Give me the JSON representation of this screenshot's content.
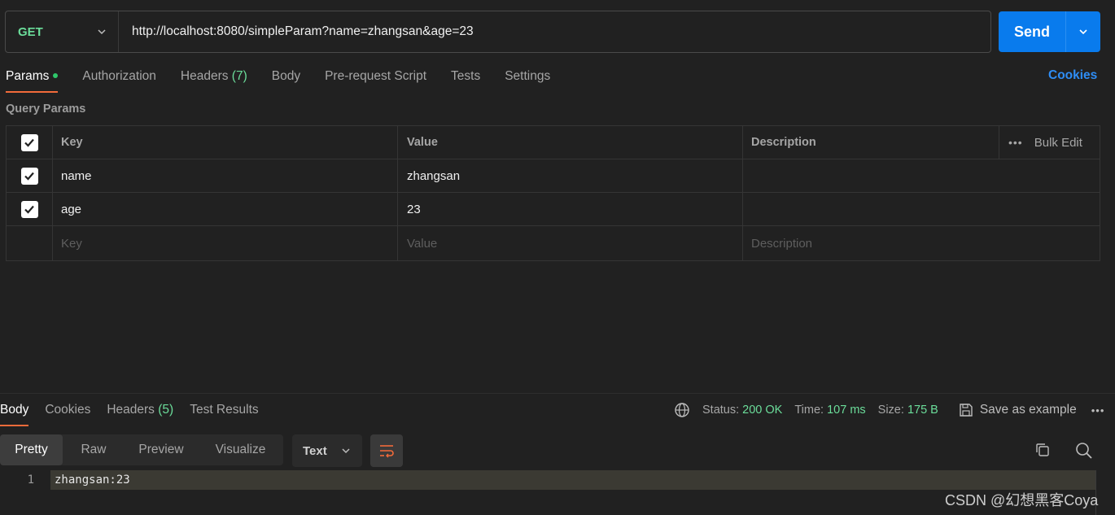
{
  "request": {
    "method": "GET",
    "url": "http://localhost:8080/simpleParam?name=zhangsan&age=23",
    "send_label": "Send"
  },
  "request_tabs": [
    {
      "label": "Params",
      "active": true
    },
    {
      "label": "Authorization"
    },
    {
      "label": "Headers",
      "count": "(7)"
    },
    {
      "label": "Body"
    },
    {
      "label": "Pre-request Script"
    },
    {
      "label": "Tests"
    },
    {
      "label": "Settings"
    }
  ],
  "cookies_link": "Cookies",
  "query_params": {
    "section_label": "Query Params",
    "headers": {
      "key": "Key",
      "value": "Value",
      "description": "Description",
      "bulk_edit": "Bulk Edit"
    },
    "rows": [
      {
        "key": "name",
        "value": "zhangsan",
        "checked": true
      },
      {
        "key": "age",
        "value": "23",
        "checked": true
      }
    ],
    "placeholders": {
      "key": "Key",
      "value": "Value",
      "description": "Description"
    }
  },
  "response": {
    "tabs": [
      {
        "label": "Body",
        "active": true
      },
      {
        "label": "Cookies"
      },
      {
        "label": "Headers",
        "count": "(5)"
      },
      {
        "label": "Test Results"
      }
    ],
    "status_label": "Status:",
    "status_value": "200 OK",
    "time_label": "Time:",
    "time_value": "107 ms",
    "size_label": "Size:",
    "size_value": "175 B",
    "save_example": "Save as example",
    "view_modes": [
      "Pretty",
      "Raw",
      "Preview",
      "Visualize"
    ],
    "format": "Text",
    "lines": [
      {
        "number": "1",
        "text": "zhangsan:23"
      }
    ]
  },
  "watermark": "CSDN @幻想黑客Coya",
  "colors": {
    "accent": "#097bed",
    "tab_indicator": "#f26b3a",
    "success": "#6bdd9a",
    "method_get": "#6bdd9a"
  }
}
